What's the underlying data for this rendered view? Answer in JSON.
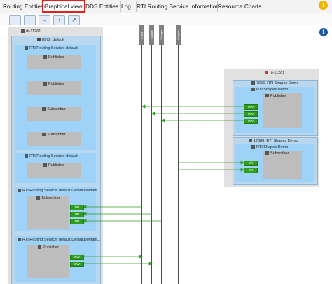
{
  "tabs": [
    {
      "label": "Routing Entities"
    },
    {
      "label": "Graphical view"
    },
    {
      "label": "DDS Entities"
    },
    {
      "label": "Log"
    },
    {
      "label": "RTI Routing Service Information"
    },
    {
      "label": "Resource Charts"
    }
  ],
  "active_tab": "Graphical view",
  "toolbar": {
    "zoom_in": "+",
    "zoom_out": "-",
    "fit": "↔",
    "up": "↑",
    "export": "↗"
  },
  "icons": {
    "warning": "!",
    "info": "i"
  },
  "topics": [
    "Circle",
    "Square",
    "Triangle",
    "Shapes"
  ],
  "left_host": {
    "label": "rti-11261",
    "app": "8972: default",
    "routing_service_1": "RTI Routing Service: default",
    "routing_service_2": "RTI Routing Service: default",
    "routing_service_3": "RTI Routing Service: default.DefaultDomain...",
    "routing_service_4": "RTI Routing Service: default.DefaultDomain...",
    "entities": {
      "publisher_1": "Publisher",
      "publisher_2": "Publisher",
      "subscriber_1": "Subscriber",
      "subscriber_2": "Subscriber",
      "publisher_3": "Publisher",
      "subscriber_3": "Subscriber",
      "publisher_4": "Publisher"
    }
  },
  "right_host": {
    "label": "rti-11261",
    "app1": {
      "title": "7656: RTI Shapes Demo",
      "domain": "RTI Shapes Demo",
      "entity": "Publisher",
      "tags": [
        "DW",
        "DW",
        "DW"
      ]
    },
    "app2": {
      "title": "17888: RTI Shapes Demo",
      "domain": "RTI Shapes Demo",
      "entity": "Subscriber",
      "tags": [
        "DR",
        "DR"
      ]
    }
  },
  "left_tags": {
    "sub3": [
      "DR",
      "DR",
      "DR"
    ],
    "pub4": [
      "DW",
      "DW"
    ]
  },
  "colors": {
    "accent": "#e0201c",
    "link": "#2f9e1f",
    "domain": "#9fd2f7"
  }
}
